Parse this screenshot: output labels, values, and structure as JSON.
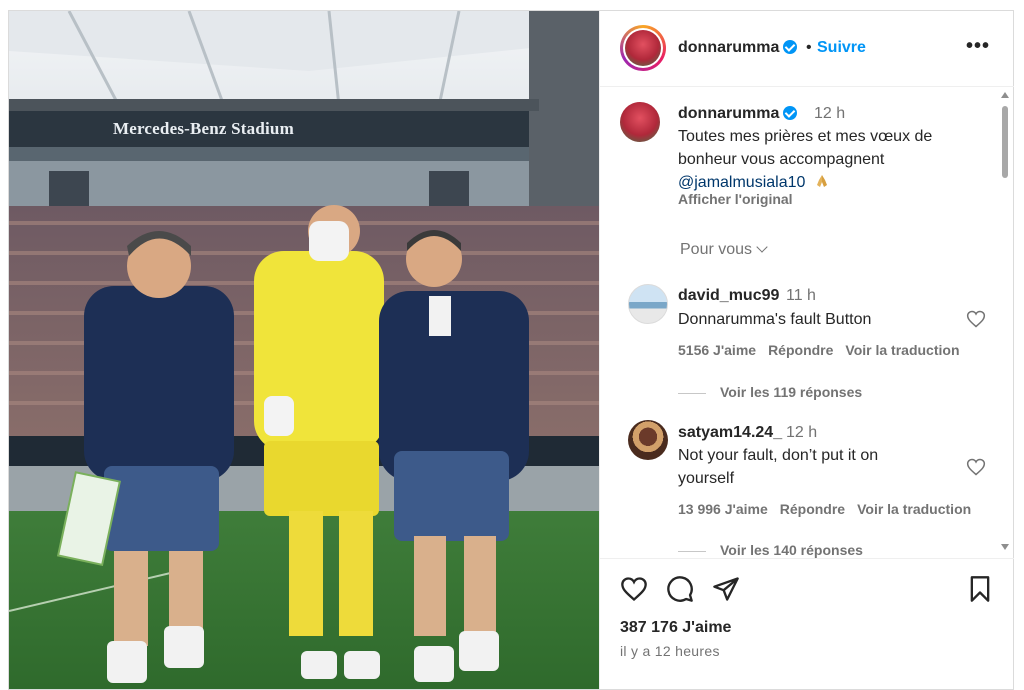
{
  "photo": {
    "stadium_banner": "Mercedes-Benz Stadium",
    "alt": "photo"
  },
  "header": {
    "username": "donnarumma",
    "separator": "•",
    "follow_label": "Suivre",
    "more_label": "•••"
  },
  "caption": {
    "username": "donnarumma",
    "time": "12 h",
    "text": "Toutes mes prières et mes vœux de bonheur vous accompagnent",
    "mention": "@jamalmusiala10",
    "see_original": "Afficher l'original"
  },
  "filter": {
    "label": "Pour vous"
  },
  "comments": [
    {
      "username": "david_muc99",
      "time": "11 h",
      "text": "Donnarumma's fault Button",
      "likes": "5156 J'aime",
      "reply": "Répondre",
      "translate": "Voir la traduction",
      "view_replies": "Voir les 119 réponses"
    },
    {
      "username": "satyam14.24_",
      "time": "12 h",
      "text": "Not your fault, don’t put it on yourself",
      "likes": "13 996 J'aime",
      "reply": "Répondre",
      "translate": "Voir la traduction",
      "view_replies": "Voir les 140 réponses"
    }
  ],
  "footer": {
    "likes": "387 176 J'aime",
    "time_ago": "il y a 12 heures"
  },
  "icons": {
    "like": "heart-icon",
    "comment": "comment-icon",
    "share": "send-icon",
    "save": "bookmark-icon"
  },
  "colors": {
    "accent": "#0095f6",
    "mention": "#00376b",
    "secondary_text": "#737373"
  }
}
